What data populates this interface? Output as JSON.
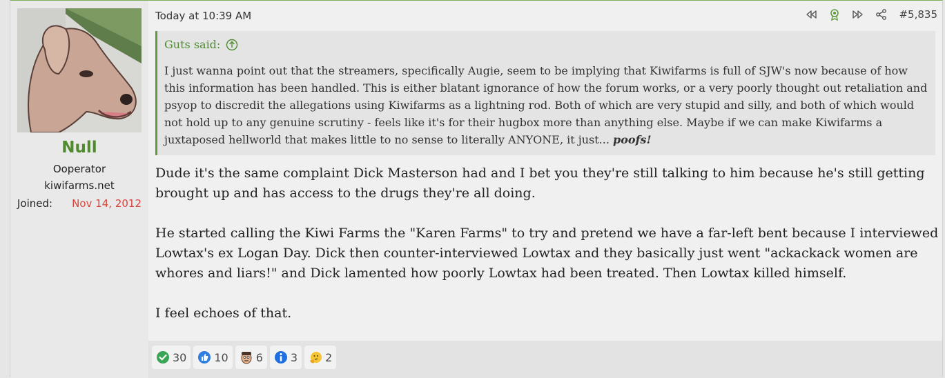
{
  "user": {
    "name": "Null",
    "title": "Ooperator",
    "host": "kiwifarms.net",
    "joined_label": "Joined:",
    "joined_value": "Nov 14, 2012"
  },
  "post": {
    "timestamp": "Today at 10:39 AM",
    "number": "#5,835",
    "quote": {
      "author": "Guts said:",
      "text": "I just wanna point out that the streamers, specifically Augie, seem to be implying that Kiwifarms is full of SJW's now because of how this information has been handled. This is either blatant ignorance of how the forum works, or a very poorly thought out retaliation and psyop to discredit the allegations using Kiwifarms as a lightning rod. Both of which are very stupid and silly, and both of which would not hold up to any genuine scrutiny - feels like it's for their hugbox more than anything else. Maybe if we can make Kiwifarms a juxtaposed hellworld that makes little to no sense to literally ANYONE, it just...",
      "emphasis": "poofs!"
    },
    "paragraphs": [
      "Dude it's the same complaint Dick Masterson had and I bet you they're still talking to him because he's still getting brought up and has access to the drugs they're all doing.",
      "He started calling the Kiwi Farms the \"Karen Farms\" to try and pretend we have a far-left bent because I interviewed Lowtax's ex Logan Day. Dick then counter-interviewed Lowtax and they basically just went \"ackackack women are whores and liars!\" and Dick lamented how poorly Lowtax had been treated. Then Lowtax killed himself.",
      "I feel echoes of that."
    ]
  },
  "reactions": [
    {
      "icon": "checkmark-icon",
      "count": "30"
    },
    {
      "icon": "thumbs-up-icon",
      "count": "10"
    },
    {
      "icon": "face-icon",
      "count": "6"
    },
    {
      "icon": "info-icon",
      "count": "3"
    },
    {
      "icon": "thinking-icon",
      "count": "2"
    }
  ],
  "colors": {
    "accent": "#4f8a2e",
    "joined": "#d9453a"
  }
}
